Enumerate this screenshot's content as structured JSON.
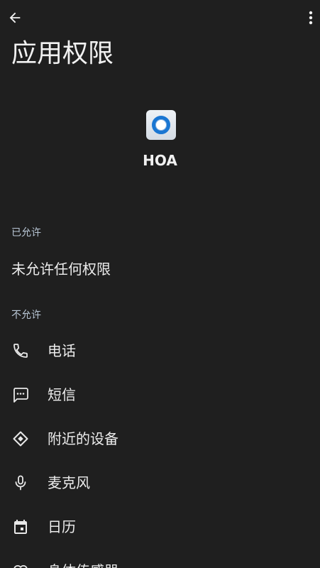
{
  "header": {
    "back_icon": "arrow-back-icon",
    "more_icon": "more-vert-icon",
    "title": "应用权限"
  },
  "app": {
    "icon": "hoa-app-icon",
    "name": "HOA"
  },
  "allowed": {
    "header": "已允许",
    "empty_text": "未允许任何权限"
  },
  "denied": {
    "header": "不允许",
    "items": [
      {
        "label": "电话",
        "icon": "phone-icon"
      },
      {
        "label": "短信",
        "icon": "sms-icon"
      },
      {
        "label": "附近的设备",
        "icon": "nearby-devices-icon"
      },
      {
        "label": "麦克风",
        "icon": "microphone-icon"
      },
      {
        "label": "日历",
        "icon": "calendar-icon"
      },
      {
        "label": "身体传感器",
        "icon": "heart-icon"
      }
    ]
  },
  "colors": {
    "background": "#1f1f1f",
    "text": "#ececec",
    "section_header": "#b9c7d6",
    "app_icon_ring": "#1a76d2"
  }
}
